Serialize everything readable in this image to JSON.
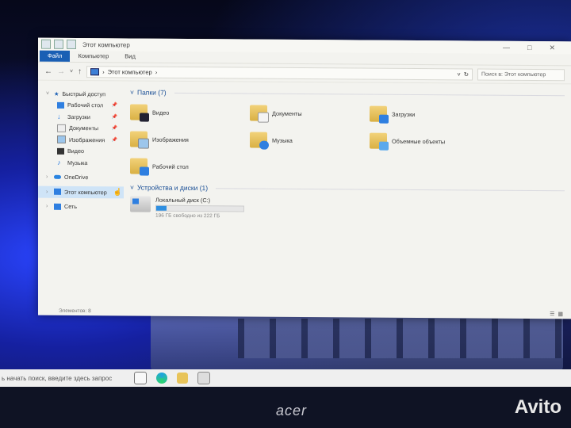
{
  "window": {
    "title": "Этот компьютер",
    "ribbon_tabs": [
      "Файл",
      "Компьютер",
      "Вид"
    ],
    "address": {
      "location": "Этот компьютер"
    },
    "search": {
      "placeholder": "Поиск в: Этот компьютер"
    },
    "controls": [
      "—",
      "□",
      "✕"
    ]
  },
  "nav_pane": {
    "items": [
      {
        "label": "Быстрый доступ",
        "icon": "star-icon",
        "level": 0
      },
      {
        "label": "Рабочий стол",
        "icon": "desktop-icon",
        "level": 1,
        "pinned": true
      },
      {
        "label": "Загрузки",
        "icon": "downloads-icon",
        "level": 1,
        "pinned": true
      },
      {
        "label": "Документы",
        "icon": "documents-icon",
        "level": 1,
        "pinned": true
      },
      {
        "label": "Изображения",
        "icon": "pictures-icon",
        "level": 1,
        "pinned": true
      },
      {
        "label": "Видео",
        "icon": "video-icon",
        "level": 1
      },
      {
        "label": "Музыка",
        "icon": "music-icon",
        "level": 1
      },
      {
        "label": "OneDrive",
        "icon": "cloud-icon",
        "level": 0
      },
      {
        "label": "Этот компьютер",
        "icon": "computer-icon",
        "level": 0,
        "selected": true
      },
      {
        "label": "Сеть",
        "icon": "network-icon",
        "level": 0
      }
    ]
  },
  "content": {
    "folders_header": "Папки (7)",
    "folders": [
      {
        "label": "Видео",
        "icon": "video-folder-icon"
      },
      {
        "label": "Документы",
        "icon": "documents-folder-icon"
      },
      {
        "label": "Загрузки",
        "icon": "downloads-folder-icon"
      },
      {
        "label": "Изображения",
        "icon": "pictures-folder-icon"
      },
      {
        "label": "Музыка",
        "icon": "music-folder-icon"
      },
      {
        "label": "Объемные объекты",
        "icon": "3d-objects-folder-icon"
      },
      {
        "label": "Рабочий стол",
        "icon": "desktop-folder-icon"
      }
    ],
    "devices_header": "Устройства и диски (1)",
    "drive": {
      "name": "Локальный диск (C:)",
      "free_text": "196 ГБ свободно из 222 ГБ",
      "used_fraction": 0.117
    }
  },
  "status_bar": {
    "items_text": "Элементов: 8"
  },
  "taskbar": {
    "search_text": "ь начать поиск, введите здесь запрос"
  },
  "bezel": {
    "brand": "acer",
    "watermark": "Avito"
  },
  "colors": {
    "accent": "#1a5fb4",
    "selection": "#cfe4f7",
    "folder": "#e8c45a"
  }
}
